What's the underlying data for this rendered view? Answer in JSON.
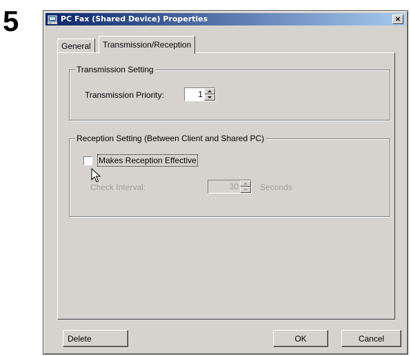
{
  "step_number": "5",
  "dialog": {
    "title": "PC Fax (Shared Device) Properties",
    "close_symbol": "×",
    "tabs": [
      {
        "label": "General",
        "active": false
      },
      {
        "label": "Transmission/Reception",
        "active": true
      }
    ]
  },
  "transmission": {
    "group_title": "Transmission Setting",
    "priority_label": "Transmission Priority:",
    "priority_value": "1"
  },
  "reception": {
    "group_title": "Reception Setting (Between Client and Shared PC)",
    "checkbox_label": "Makes Reception Effective",
    "checkbox_checked": false,
    "interval_label": "Check Interval:",
    "interval_value": "30",
    "interval_unit": "Seconds",
    "interval_enabled": false
  },
  "buttons": {
    "delete_label": "Delete",
    "ok_label": "OK",
    "cancel_label": "Cancel"
  },
  "icons": {
    "title_icon": "fax-device-icon",
    "cursor": "mouse-pointer-icon"
  }
}
